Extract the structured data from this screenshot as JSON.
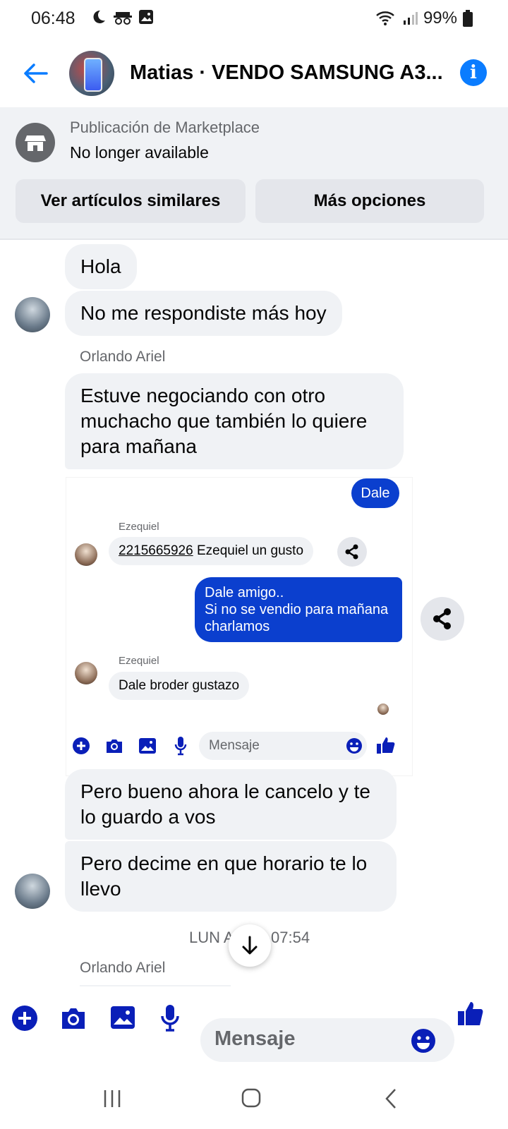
{
  "status_bar": {
    "time": "06:48",
    "battery": "99%"
  },
  "header": {
    "title": "Matias · VENDO SAMSUNG A3..."
  },
  "marketplace": {
    "label": "Publicación de Marketplace",
    "status": "No longer available",
    "btn_similar": "Ver artículos similares",
    "btn_more": "Más opciones"
  },
  "messages": {
    "m1": "Hola",
    "m2": "No me respondiste más hoy",
    "sender1": "Orlando Ariel",
    "m3_l1": "Estuve negociando con otro",
    "m3_l2": "muchacho que también  lo quiere",
    "m3_l3": "para mañana",
    "m4_l1": "Pero bueno ahora le cancelo y te",
    "m4_l2": "lo guardo a vos",
    "m5_l1": "Pero decime en que horario te lo",
    "m5_l2": "llevo",
    "timestamp_a": "LUN A",
    "timestamp_b": "07:54",
    "sender2": "Orlando Ariel"
  },
  "embedded": {
    "dale": "Dale",
    "sender_a": "Ezequiel",
    "phone": "2215665926",
    "phone_rest": " Ezequiel un gusto",
    "out_l1": "Dale amigo..",
    "out_l2": "Si no se vendio para mañana",
    "out_l3": "charlamos",
    "sender_b": "Ezequiel",
    "reply": "Dale broder gustazo",
    "composer_placeholder": "Mensaje"
  },
  "composer": {
    "placeholder": "Mensaje"
  },
  "colors": {
    "accent": "#0a7cff",
    "composer_icons": "#0a1fb8",
    "embed_outgoing": "#0b3fce"
  }
}
